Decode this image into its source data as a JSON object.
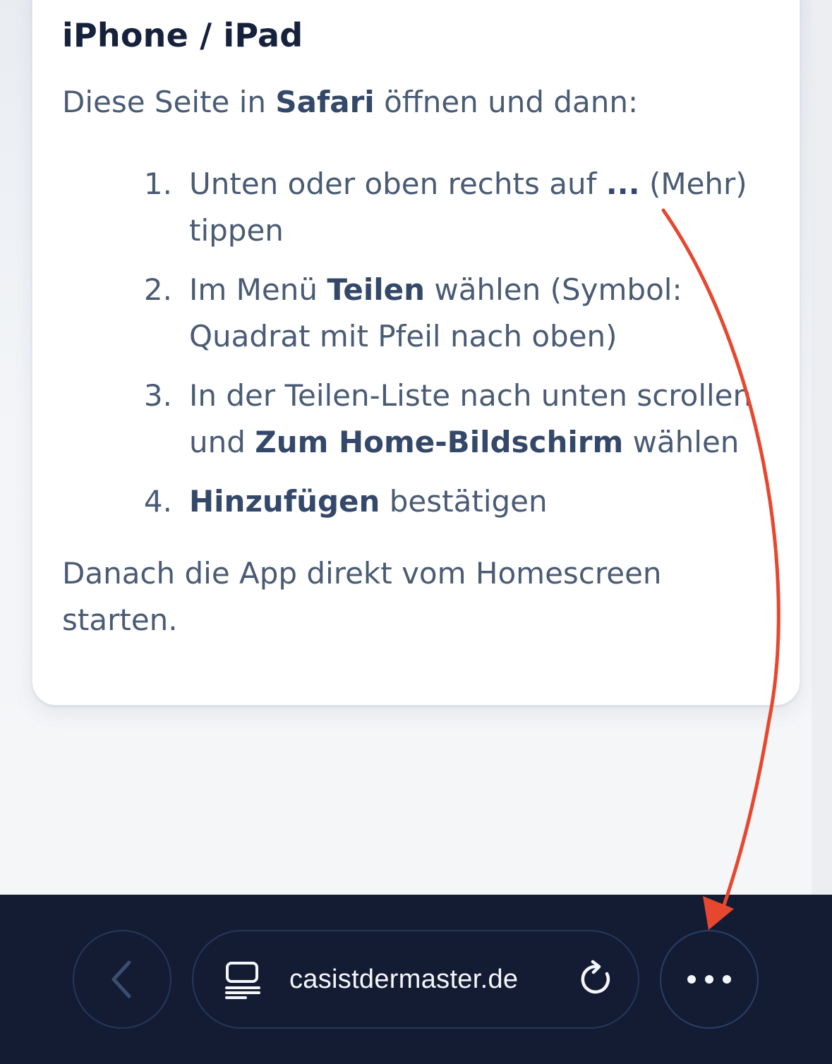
{
  "card": {
    "title": "iPhone / iPad",
    "intro": {
      "before": "Diese Seite in ",
      "bold": "Safari",
      "after": " öffnen und dann:"
    },
    "steps": [
      {
        "number": "1.",
        "line1_before": "Unten oder oben rechts auf ",
        "line1_bold": "...",
        "line1_after": " (Mehr)",
        "line2": "tippen"
      },
      {
        "number": "2.",
        "line1_before": "Im Menü ",
        "line1_bold": "Teilen",
        "line1_after": " wählen (Symbol:",
        "line2": "Quadrat mit Pfeil nach oben)"
      },
      {
        "number": "3.",
        "line1": "In der Teilen-Liste nach unten scrollen",
        "line2_before": "und ",
        "line2_bold": "Zum Home-Bildschirm",
        "line2_after": " wählen"
      },
      {
        "number": "4.",
        "line1_bold": "Hinzufügen",
        "line1_after": " bestätigen"
      }
    ],
    "outro": {
      "line1": "Danach die App direkt vom Homescreen",
      "line2": "starten."
    }
  },
  "toolbar": {
    "url": "casistdermaster.de",
    "icons": {
      "back": "chevron-left-icon",
      "reader": "reader-view-icon",
      "reload": "reload-icon",
      "more": "ellipsis-icon"
    }
  },
  "annotation": {
    "arrow_color": "#e8472f"
  },
  "colors": {
    "toolbar_bg": "#131c33",
    "text": "#4a5b74",
    "heading": "#16213b"
  }
}
